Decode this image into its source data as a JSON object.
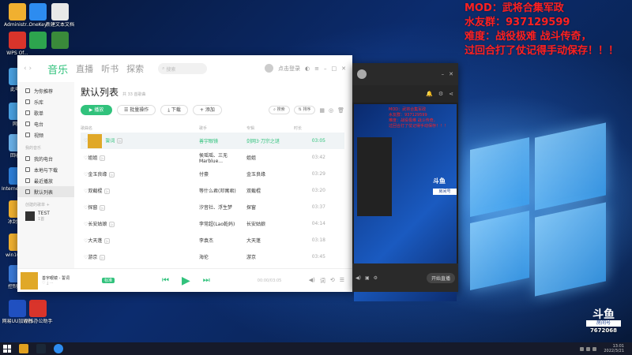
{
  "overlay": {
    "line1": "MOD：武将合集军政",
    "line2": "水友群：937129599",
    "line3": "难度：战役极难 战斗传奇，",
    "line4": "过回合打了仗记得手动保存！！！"
  },
  "desktop_icons": [
    {
      "label": "Administr...",
      "color": "#f0b030"
    },
    {
      "label": "OneKey",
      "color": "#2d8cf0"
    },
    {
      "label": "新建文本文档",
      "color": "#e8e8e8"
    },
    {
      "label": "WPS Of...",
      "color": "#d9342b"
    },
    {
      "label": "",
      "color": "#2da44e"
    },
    {
      "label": "",
      "color": "#3a8a3a"
    },
    {
      "label": "此电脑",
      "color": "#4aa0e0"
    },
    {
      "label": "网络",
      "color": "#4aa0e0"
    },
    {
      "label": "回收站",
      "color": "#6ab0e8"
    },
    {
      "label": "Internet Explorer",
      "color": "#2d7fd8"
    },
    {
      "label": "冰封数据",
      "color": "#f0b030"
    },
    {
      "label": "win10激活",
      "color": "#f0b030"
    },
    {
      "label": "控制面板",
      "color": "#3a7ad8"
    },
    {
      "label": "网易UU加速器",
      "color": "#2050c0"
    },
    {
      "label": "WPS办公助手",
      "color": "#d9342b"
    }
  ],
  "music": {
    "tabs": [
      "音乐",
      "直播",
      "听书",
      "探索"
    ],
    "search_placeholder": "搜索",
    "user_label": "点击登录",
    "sidebar": {
      "items": [
        "为你推荐",
        "乐库",
        "歌单",
        "电台",
        "视频"
      ],
      "my_music_header": "我的音乐",
      "my_items": [
        "我的电台",
        "本地与下载",
        "最近播放",
        "默认列表"
      ],
      "created_header": "创建的歌单",
      "playlist_name": "TEST",
      "playlist_count": "1首"
    },
    "title": "默认列表",
    "title_sub": "共 33 首歌曲",
    "toolbar": {
      "play_all": "播放",
      "batch": "批量操作",
      "download": "下载",
      "add": "添加",
      "search": "搜索",
      "sort": "排序"
    },
    "columns": {
      "song": "歌曲名",
      "artist": "歌手",
      "album": "专辑",
      "duration": "时长"
    },
    "songs": [
      {
        "name": "誓词",
        "artist": "善宇眼镜",
        "album": "剑网3·刀宗之谜",
        "duration": "03:05"
      },
      {
        "name": "姐姐",
        "artist": "侯瑶瑶、三无Marblue...",
        "album": "姐姐",
        "duration": "03:42"
      },
      {
        "name": "金玉良缘",
        "artist": "付豪",
        "album": "金玉良缘",
        "duration": "03:29"
      },
      {
        "name": "双截棍",
        "artist": "等什么君(邓寓君)",
        "album": "双截棍",
        "duration": "03:20"
      },
      {
        "name": "探窗",
        "artist": "汐音社、浮生梦",
        "album": "探窗",
        "duration": "03:37"
      },
      {
        "name": "长安姑娘",
        "artist": "李常超(Lao乾妈)",
        "album": "长安姑娘",
        "duration": "04:14"
      },
      {
        "name": "大天蓬",
        "artist": "李袁杰",
        "album": "大天蓬",
        "duration": "03:18"
      },
      {
        "name": "游京",
        "artist": "海伦",
        "album": "游京",
        "duration": "03:45"
      }
    ],
    "player": {
      "now_playing": "善宇眼镜 - 誓词",
      "badge": "标准",
      "time": "00:00/03:05"
    }
  },
  "stream": {
    "mini_text": "MOD：武将合集军政\n水友群：937129599\n难度：战役极难 战斗传奇\n过回合打了仗记得手动保存！！！",
    "logo": "斗鱼",
    "logo_sub": "房间号",
    "live_button": "开始直播"
  },
  "watermark": {
    "brand": "斗鱼",
    "sub": "房间号",
    "room": "7672068"
  },
  "taskbar": {
    "time": "13:01",
    "date": "2022/3/21"
  }
}
